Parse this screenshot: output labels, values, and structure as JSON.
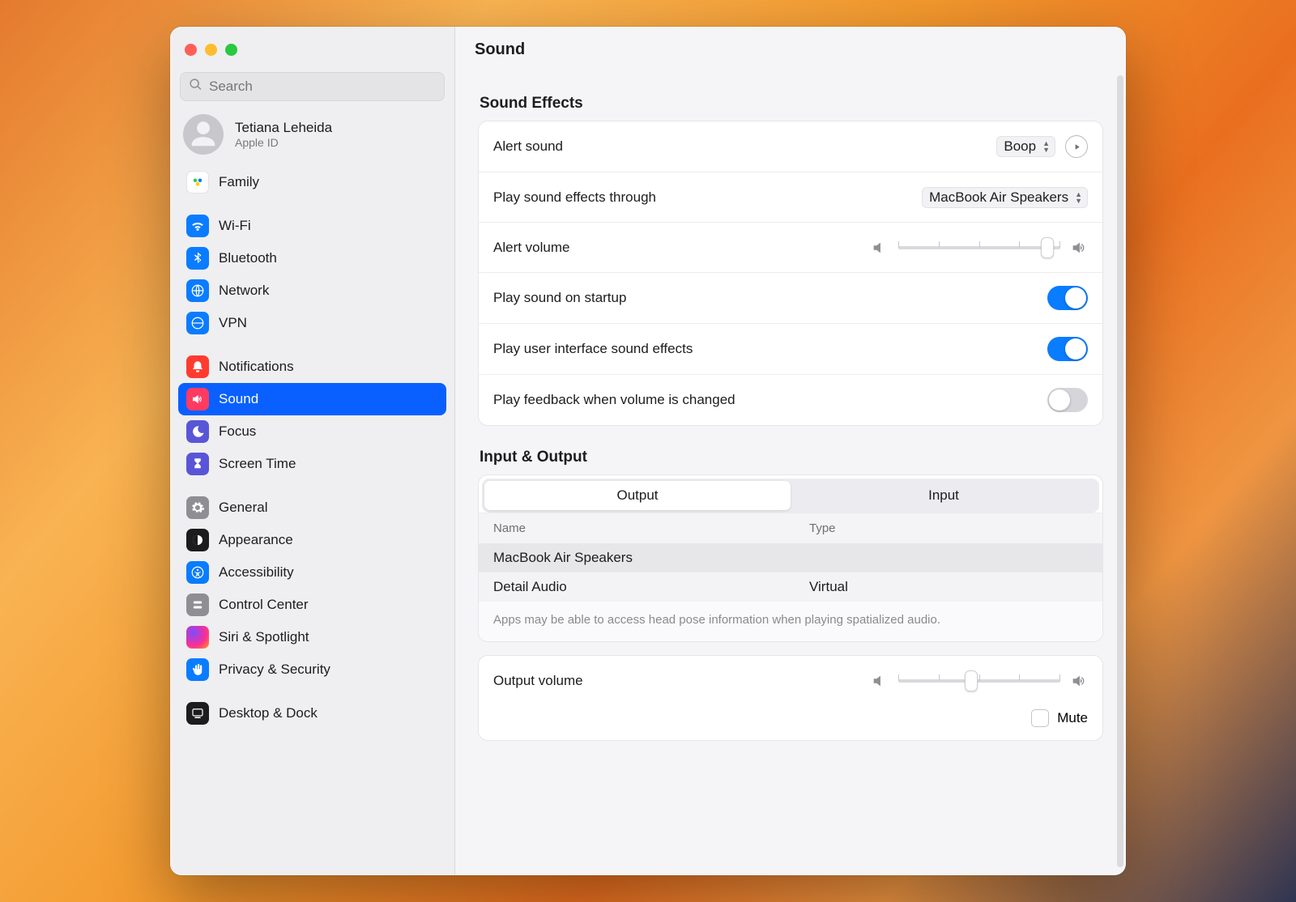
{
  "search": {
    "placeholder": "Search"
  },
  "account": {
    "name": "Tetiana Leheida",
    "sub": "Apple ID"
  },
  "sidebar": {
    "items": [
      {
        "label": "Family"
      },
      {
        "label": "Wi-Fi"
      },
      {
        "label": "Bluetooth"
      },
      {
        "label": "Network"
      },
      {
        "label": "VPN"
      },
      {
        "label": "Notifications"
      },
      {
        "label": "Sound"
      },
      {
        "label": "Focus"
      },
      {
        "label": "Screen Time"
      },
      {
        "label": "General"
      },
      {
        "label": "Appearance"
      },
      {
        "label": "Accessibility"
      },
      {
        "label": "Control Center"
      },
      {
        "label": "Siri & Spotlight"
      },
      {
        "label": "Privacy & Security"
      },
      {
        "label": "Desktop & Dock"
      }
    ]
  },
  "header": {
    "title": "Sound"
  },
  "effects": {
    "title": "Sound Effects",
    "alert_sound_label": "Alert sound",
    "alert_sound_value": "Boop",
    "play_through_label": "Play sound effects through",
    "play_through_value": "MacBook Air Speakers",
    "alert_volume_label": "Alert volume",
    "alert_volume_percent": 92,
    "startup_label": "Play sound on startup",
    "startup_on": true,
    "ui_sounds_label": "Play user interface sound effects",
    "ui_sounds_on": true,
    "feedback_label": "Play feedback when volume is changed",
    "feedback_on": false
  },
  "io": {
    "title": "Input & Output",
    "tabs": {
      "output": "Output",
      "input": "Input",
      "active": "output"
    },
    "columns": {
      "name": "Name",
      "type": "Type"
    },
    "rows": [
      {
        "name": "MacBook Air Speakers",
        "type": ""
      },
      {
        "name": "Detail Audio",
        "type": "Virtual"
      }
    ],
    "note": "Apps may be able to access head pose information when playing spatialized audio."
  },
  "output": {
    "label": "Output volume",
    "percent": 45,
    "mute_label": "Mute",
    "mute_on": false
  }
}
